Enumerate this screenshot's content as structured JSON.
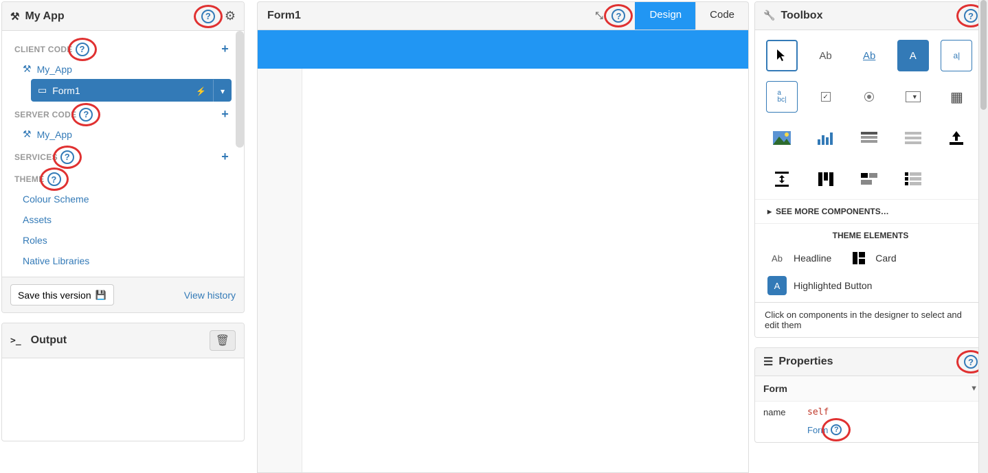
{
  "left_panel": {
    "title": "My App",
    "sections": {
      "client_code": {
        "label": "CLIENT CODE",
        "items": [
          "My_App"
        ],
        "form": "Form1"
      },
      "server_code": {
        "label": "SERVER CODE",
        "items": [
          "My_App"
        ]
      },
      "services": {
        "label": "SERVICES"
      },
      "theme": {
        "label": "THEME",
        "items": [
          "Colour Scheme",
          "Assets",
          "Roles",
          "Native Libraries"
        ]
      }
    },
    "footer": {
      "save_btn": "Save this version",
      "history_link": "View history"
    }
  },
  "output_panel": {
    "title": "Output"
  },
  "mid_panel": {
    "form_title": "Form1",
    "tabs": {
      "design": "Design",
      "code": "Code"
    }
  },
  "right_panel": {
    "toolbox_title": "Toolbox",
    "tools_row1": [
      "pointer",
      "label",
      "link",
      "button",
      "textbox"
    ],
    "tools_row2": [
      "textarea",
      "checkbox",
      "radio",
      "dropdown",
      "date"
    ],
    "tools_row3": [
      "image",
      "plot",
      "datagrid",
      "repeatingpanel",
      "fileloader"
    ],
    "tools_row4": [
      "spacer",
      "columnpanel",
      "flowpanel",
      "linearpanel",
      ""
    ],
    "see_more": "SEE MORE COMPONENTS…",
    "theme_heading": "THEME ELEMENTS",
    "theme_items": {
      "headline": "Headline",
      "card": "Card",
      "hl_button": "Highlighted Button"
    },
    "hint": "Click on components in the designer to select and edit them",
    "properties_title": "Properties",
    "prop_type": "Form",
    "props": {
      "name_key": "name",
      "name_val": "self",
      "extra": "Form"
    }
  }
}
